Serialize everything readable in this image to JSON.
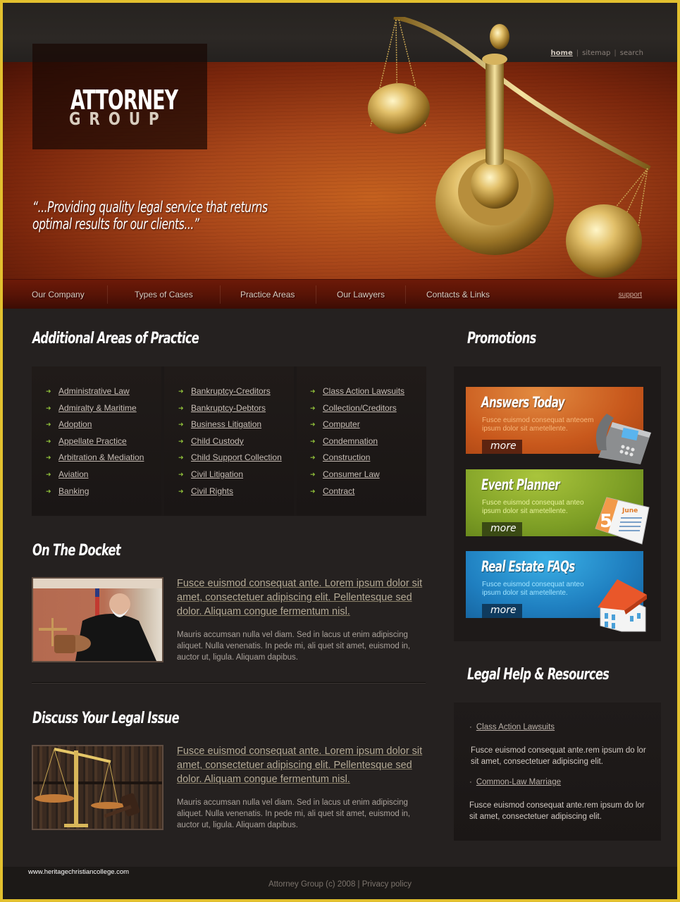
{
  "header": {
    "logo_main": "ATTORNEY",
    "logo_sub": "GROUP",
    "top_links": [
      {
        "label": "home",
        "active": true
      },
      {
        "label": "sitemap",
        "active": false
      },
      {
        "label": "search",
        "active": false
      }
    ],
    "top_link_separator": "|",
    "tagline_line1": "“...Providing quality legal service that returns",
    "tagline_line2": "optimal results for our clients...”"
  },
  "nav": {
    "items": [
      "Our Company",
      "Types of Cases",
      "Practice Areas",
      "Our Lawyers",
      "Contacts & Links"
    ],
    "support_label": "support"
  },
  "practice": {
    "title": "Additional Areas of Practice",
    "columns": [
      [
        "Administrative Law",
        "Admiralty & Maritime",
        "Adoption",
        "Appellate Practice",
        "Arbitration & Mediation",
        "Aviation",
        "Banking"
      ],
      [
        "Bankruptcy-Creditors",
        "Bankruptcy-Debtors",
        "Business Litigation",
        "Child Custody",
        "Child Support Collection",
        "Civil Litigation",
        "Civil Rights"
      ],
      [
        "Class Action Lawsuits",
        "Collection/Creditors",
        "Computer",
        "Condemnation",
        "Construction",
        "Consumer Law",
        "Contract"
      ]
    ],
    "bullet_icon": "green-arrow-icon"
  },
  "docket": {
    "title": "On The Docket",
    "lead": "Fusce euismod consequat ante. Lorem ipsum dolor sit amet, consectetuer adipiscing elit. Pellentesque sed dolor. Aliquam congue fermentum nisl.",
    "body": "Mauris accumsan nulla vel diam. Sed in lacus ut enim adipiscing aliquet. Nulla venenatis. In pede mi, ali quet sit amet, euismod in, auctor ut, ligula. Aliquam dapibus.",
    "image": "judge-with-gavel-photo"
  },
  "discuss": {
    "title": "Discuss Your Legal Issue",
    "lead": "Fusce euismod consequat ante. Lorem ipsum dolor sit amet, consectetuer adipiscing elit. Pellentesque sed dolor. Aliquam congue fermentum nisl.",
    "body": "Mauris accumsan nulla vel diam. Sed in lacus ut enim adipiscing aliquet. Nulla venenatis. In pede mi, ali quet sit amet, euismod in, auctor ut, ligula. Aliquam dapibus.",
    "image": "scales-and-gavel-photo"
  },
  "promotions": {
    "title": "Promotions",
    "items": [
      {
        "title": "Answers Today",
        "text": "Fusce euismod consequat anteoem ipsum dolor sit ametellente.",
        "more": "more",
        "icon": "telephone-icon",
        "color": "#c8581c",
        "text_color": "#f7b77a"
      },
      {
        "title": "Event Planner",
        "text": "Fusce euismod consequat anteo ipsum dolor sit ametellente.",
        "more": "more",
        "icon": "calendar-icon",
        "calendar_day": "5",
        "calendar_month": "June",
        "color": "#7d9e25",
        "text_color": "#e6f19a"
      },
      {
        "title": "Real Estate FAQs",
        "text": "Fusce euismod consequat anteo ipsum dolor sit ametellente.",
        "more": "more",
        "icon": "house-icon",
        "color": "#1f7fc0",
        "text_color": "#9fe3ff"
      }
    ]
  },
  "resources": {
    "title": "Legal Help & Resources",
    "items": [
      {
        "link": "Class Action Lawsuits",
        "text": "Fusce euismod consequat ante.rem ipsum do lor sit amet, consectetuer adipiscing elit."
      },
      {
        "link": "Common-Law Marriage",
        "text": "Fusce euismod consequat ante.rem ipsum do lor sit amet, consectetuer adipiscing elit."
      }
    ]
  },
  "footer": {
    "copyright": "Attorney Group (c) 2008 | Privacy policy",
    "watermark": "www.heritagechristiancollege.com"
  },
  "colors": {
    "frame_border": "#e2c02e",
    "page_bg": "#252120",
    "banner_wood": "#a9471a",
    "bullet_green": "#8fbf3a"
  }
}
